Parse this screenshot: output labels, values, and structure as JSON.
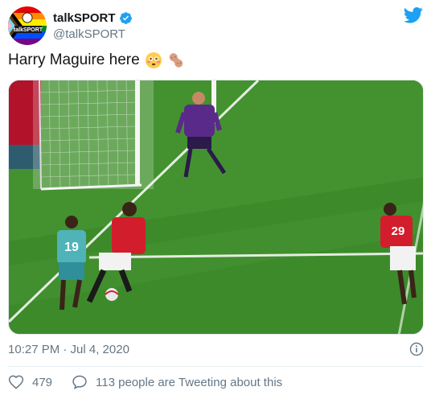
{
  "author": {
    "display_name": "talkSPORT",
    "handle": "@talkSPORT",
    "avatar_text": "talkSPORT",
    "verified_icon": "verified-badge-icon"
  },
  "tweet": {
    "text": "Harry Maguire here",
    "emojis": [
      "flushed-face-emoji",
      "peanut-emoji"
    ]
  },
  "media": {
    "type": "video-still",
    "description_icon": "football-scene"
  },
  "meta": {
    "timestamp": "10:27 PM · Jul 4, 2020"
  },
  "actions": {
    "likes_count": "479",
    "conversation_label": "113 people are Tweeting about this"
  },
  "colors": {
    "twitter_blue": "#1da1f2",
    "text_primary": "#14171a",
    "text_secondary": "#657786",
    "divider": "#e6ecf0"
  }
}
